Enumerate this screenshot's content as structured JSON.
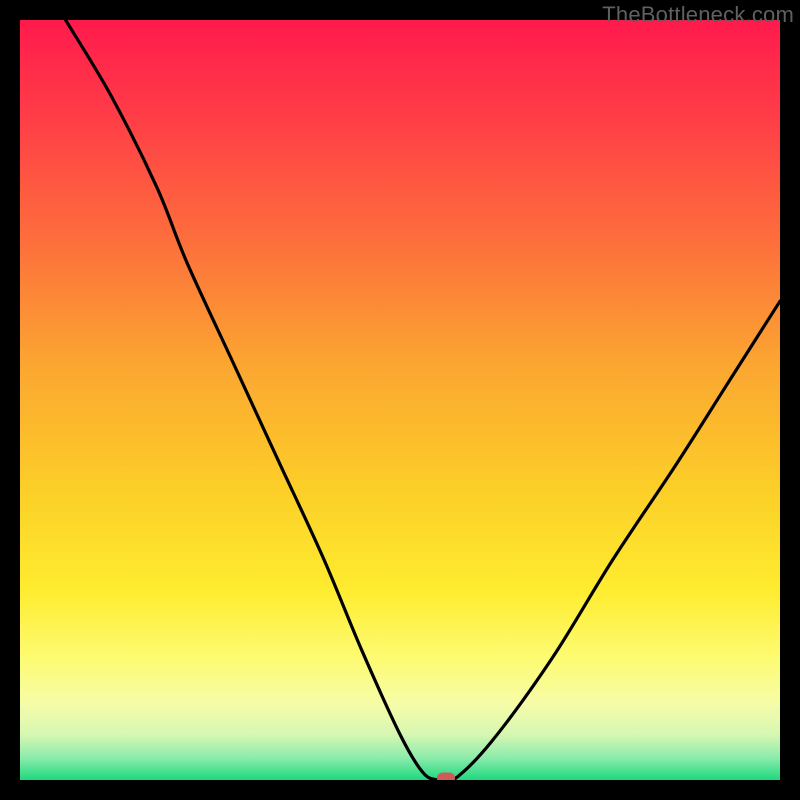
{
  "watermark": "TheBottleneck.com",
  "colors": {
    "curve": "#000000",
    "marker": "#cf5b59",
    "frame": "#000000"
  },
  "chart_data": {
    "type": "line",
    "title": "",
    "xlabel": "",
    "ylabel": "",
    "xlim": [
      0,
      100
    ],
    "ylim": [
      0,
      100
    ],
    "grid": false,
    "legend": false,
    "notes": "V-shaped bottleneck curve over a vertical red→yellow→green gradient. Minimum near x≈55–57 at y≈0. Left branch starts at y=100 at x≈6 with a knee around x≈22,y≈68 then drops steeply to the flat bottom; right branch rises with slight convexity to y≈63 at x=100.",
    "series": [
      {
        "name": "bottleneck",
        "x": [
          6,
          12,
          18,
          22,
          28,
          34,
          40,
          45,
          50,
          53,
          55,
          57,
          62,
          70,
          78,
          86,
          93,
          100
        ],
        "y": [
          100,
          90,
          78,
          68,
          55,
          42,
          29,
          17,
          6,
          1,
          0,
          0,
          5,
          16,
          29,
          41,
          52,
          63
        ]
      }
    ],
    "optimal_point": {
      "x": 56,
      "y": 0
    }
  }
}
